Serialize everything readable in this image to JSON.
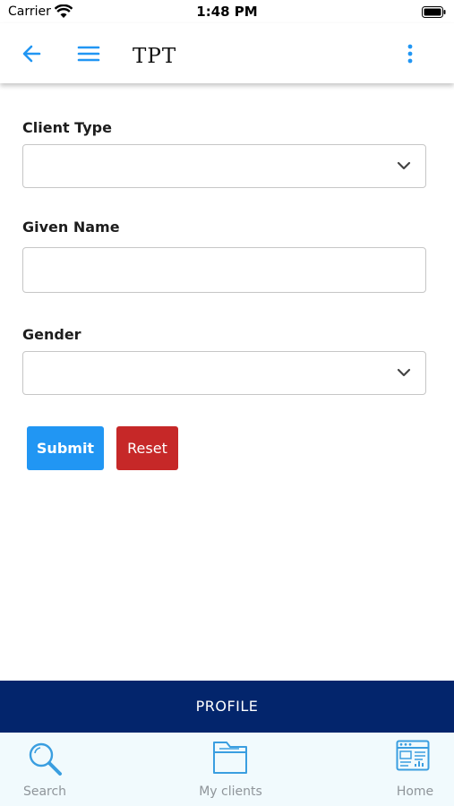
{
  "status_bar": {
    "carrier": "Carrier",
    "time": "1:48 PM"
  },
  "app_bar": {
    "title": "TPT"
  },
  "form": {
    "client_type": {
      "label": "Client Type",
      "value": ""
    },
    "given_name": {
      "label": "Given Name",
      "value": ""
    },
    "gender": {
      "label": "Gender",
      "value": ""
    },
    "submit_label": "Submit",
    "reset_label": "Reset"
  },
  "profile_bar": {
    "label": "PROFILE"
  },
  "tabs": [
    {
      "label": "Search",
      "icon": "search-icon"
    },
    {
      "label": "My clients",
      "icon": "folder-icon"
    },
    {
      "label": "Home",
      "icon": "dashboard-icon"
    }
  ],
  "colors": {
    "accent": "#2196f3",
    "danger": "#c62828",
    "profile_bar": "#03256c",
    "tab_bar": "#f1fafd",
    "tab_icon": "#3a9ee0"
  }
}
